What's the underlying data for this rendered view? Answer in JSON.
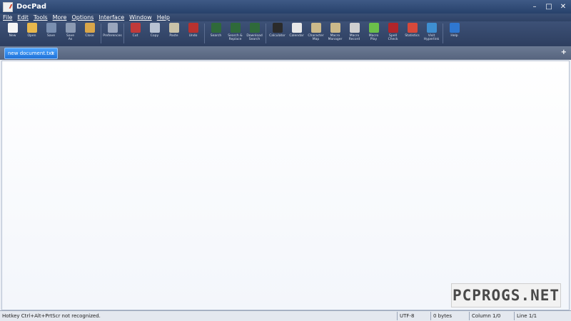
{
  "window": {
    "title": "DocPad"
  },
  "window_controls": {
    "minimize": "–",
    "maximize": "□",
    "close": "✕"
  },
  "menu": [
    "File",
    "Edit",
    "Tools",
    "More",
    "Options",
    "Interface",
    "Window",
    "Help"
  ],
  "toolbar": {
    "groups": [
      [
        {
          "name": "new",
          "label": "New",
          "icon": "new-document-icon",
          "color": "#f5f5f5"
        },
        {
          "name": "open",
          "label": "Open",
          "icon": "open-folder-icon",
          "color": "#e9b84c"
        },
        {
          "name": "save",
          "label": "Save",
          "icon": "save-floppy-icon",
          "color": "#7a8fb0"
        },
        {
          "name": "save-as",
          "label": "Save\nAs",
          "icon": "save-as-icon",
          "color": "#8b9ab3"
        },
        {
          "name": "close",
          "label": "Close",
          "icon": "close-folder-icon",
          "color": "#d9a64a"
        }
      ],
      [
        {
          "name": "preferences",
          "label": "Preferences",
          "icon": "preferences-icon",
          "color": "#9aa6bd"
        }
      ],
      [
        {
          "name": "cut",
          "label": "Cut",
          "icon": "scissors-icon",
          "color": "#c03a3a"
        },
        {
          "name": "copy",
          "label": "Copy",
          "icon": "copy-icon",
          "color": "#b8c2d2"
        },
        {
          "name": "paste",
          "label": "Paste",
          "icon": "paste-icon",
          "color": "#c9c2a8"
        },
        {
          "name": "undo",
          "label": "Undo",
          "icon": "undo-icon",
          "color": "#b8322f"
        }
      ],
      [
        {
          "name": "search",
          "label": "Search",
          "icon": "binoculars-icon",
          "color": "#2f6a3a"
        },
        {
          "name": "search-replace",
          "label": "Search &\nReplace",
          "icon": "search-replace-icon",
          "color": "#2f6a3a"
        },
        {
          "name": "download-search",
          "label": "Download\nSearch",
          "icon": "download-search-icon",
          "color": "#2f6a3a"
        }
      ],
      [
        {
          "name": "calculator",
          "label": "Calculator",
          "icon": "calculator-icon",
          "color": "#2b2b2b"
        },
        {
          "name": "calendar",
          "label": "Calendar",
          "icon": "calendar-icon",
          "color": "#e8e8e8"
        },
        {
          "name": "character-map",
          "label": "Character\nMap",
          "icon": "character-map-icon",
          "color": "#cbb98a"
        },
        {
          "name": "macro-manager",
          "label": "Macro\nManager",
          "icon": "macro-manager-icon",
          "color": "#cbb98a"
        },
        {
          "name": "macro-record",
          "label": "Macro\nRecord",
          "icon": "macro-record-icon",
          "color": "#cfcfcf"
        },
        {
          "name": "macro-play",
          "label": "Macro\nPlay",
          "icon": "macro-play-icon",
          "color": "#6bbf4a"
        },
        {
          "name": "spell-check",
          "label": "Spell\nCheck",
          "icon": "spell-check-icon",
          "color": "#b1252a"
        },
        {
          "name": "statistics",
          "label": "Statistics",
          "icon": "pie-chart-icon",
          "color": "#d6493b"
        },
        {
          "name": "visit-hyperlink",
          "label": "Visit\nHyperlink",
          "icon": "globe-icon",
          "color": "#3e8fd1"
        }
      ],
      [
        {
          "name": "help",
          "label": "Help",
          "icon": "help-icon",
          "color": "#2f77d0"
        }
      ]
    ]
  },
  "tabs": [
    {
      "label": "new document.txt",
      "close": "×"
    }
  ],
  "add_tab": "+",
  "status": {
    "message": "Hotkey Ctrl+Alt+PrtScr not recognized.",
    "encoding": "UTF-8",
    "size": "0 bytes",
    "column": "Column 1/0",
    "line": "Line 1/1"
  },
  "watermark": "PCPROGS.NET"
}
